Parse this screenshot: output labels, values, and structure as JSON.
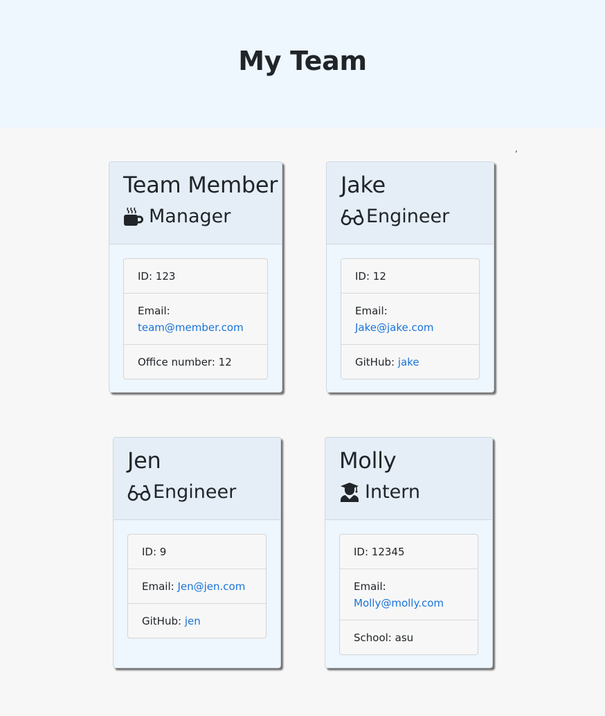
{
  "header": {
    "title": "My Team"
  },
  "stray_mark": ",",
  "cards": [
    {
      "name": "Team Member",
      "role": "Manager",
      "role_icon": "mug-hot-icon",
      "id_label": "ID: ",
      "id": "123",
      "email_label": "Email: ",
      "email": "team@member.com",
      "extra_label": "Office number: ",
      "extra_value": "12"
    },
    {
      "name": "Jake",
      "role": "Engineer",
      "role_icon": "glasses-icon",
      "id_label": "ID: ",
      "id": "12",
      "email_label": "Email: ",
      "email": "Jake@jake.com",
      "extra_label": "GitHub: ",
      "extra_value": "jake"
    },
    {
      "name": "Jen",
      "role": "Engineer",
      "role_icon": "glasses-icon",
      "id_label": "ID: ",
      "id": "9",
      "email_label": "Email: ",
      "email": "Jen@jen.com",
      "extra_label": "GitHub: ",
      "extra_value": "jen"
    },
    {
      "name": "Molly",
      "role": "Intern",
      "role_icon": "user-graduate-icon",
      "id_label": "ID: ",
      "id": "12345",
      "email_label": "Email: ",
      "email": "Molly@molly.com",
      "extra_label": "School: ",
      "extra_value": "asu"
    }
  ]
}
